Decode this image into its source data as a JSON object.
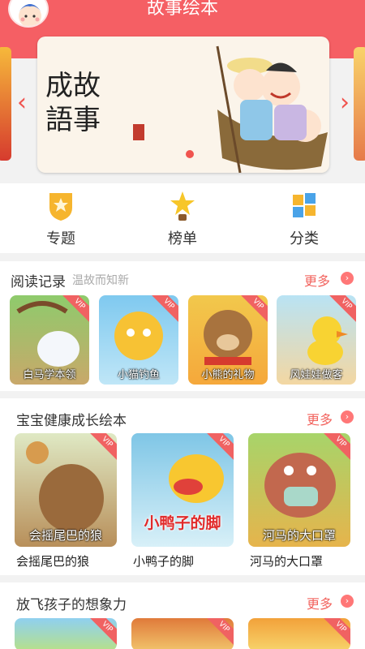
{
  "header": {
    "title": "故事绘本"
  },
  "banner": {
    "calligraphy": "成故\n語事"
  },
  "categories": [
    {
      "label": "专题",
      "icon": "shield-star-icon"
    },
    {
      "label": "榜单",
      "icon": "trophy-star-icon"
    },
    {
      "label": "分类",
      "icon": "blocks-icon"
    }
  ],
  "reading": {
    "title": "阅读记录",
    "subtitle": "温故而知新",
    "more": "更多",
    "items": [
      {
        "caption": "白马学本领",
        "vip": "VIP"
      },
      {
        "caption": "小猫钓鱼",
        "vip": "VIP"
      },
      {
        "caption": "小熊的礼物",
        "vip": "VIP"
      },
      {
        "caption": "风娃娃做客",
        "vip": "VIP"
      }
    ]
  },
  "health": {
    "title": "宝宝健康成长绘本",
    "more": "更多",
    "items": [
      {
        "caption": "会摇尾巴的狼",
        "title": "会摇尾巴的狼",
        "vip": "VIP"
      },
      {
        "caption": "小鸭子的脚",
        "title": "小鸭子的脚",
        "vip": "VIP"
      },
      {
        "caption": "河马的大口罩",
        "title": "河马的大口罩",
        "vip": "VIP"
      }
    ]
  },
  "imagination": {
    "title": "放飞孩子的想象力",
    "more": "更多",
    "items": [
      {
        "vip": "VIP"
      },
      {
        "vip": "VIP"
      },
      {
        "vip": "VIP"
      }
    ]
  },
  "colors": {
    "accent": "#f55f64",
    "more": "#f2635e"
  }
}
